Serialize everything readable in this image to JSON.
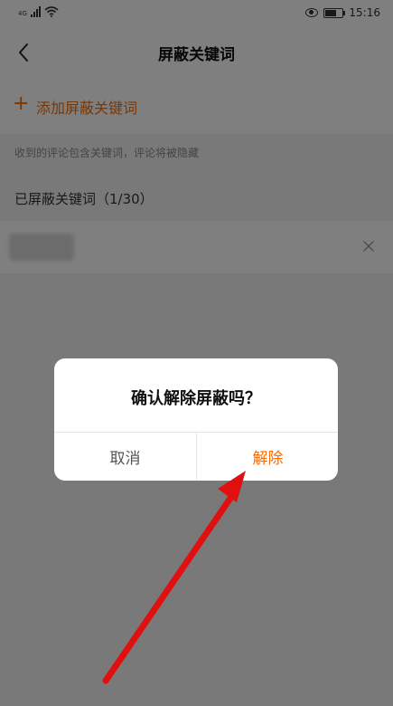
{
  "status_bar": {
    "network_label": "4G",
    "time": "15:16"
  },
  "nav": {
    "title": "屏蔽关键词"
  },
  "add_section": {
    "plus": "+",
    "label": "添加屏蔽关键词"
  },
  "hint": "收到的评论包含关键词，评论将被隐藏",
  "list": {
    "header": "已屏蔽关键词（1/30）"
  },
  "dialog": {
    "title": "确认解除屏蔽吗？",
    "cancel_label": "取消",
    "confirm_label": "解除"
  },
  "colors": {
    "accent": "#ff6a00",
    "overlay": "rgba(0,0,0,0.5)",
    "arrow": "#e01010"
  },
  "icons": [
    "back-arrow-icon",
    "plus-icon",
    "close-icon",
    "signal-icon",
    "wifi-icon",
    "eye-icon",
    "battery-icon"
  ]
}
